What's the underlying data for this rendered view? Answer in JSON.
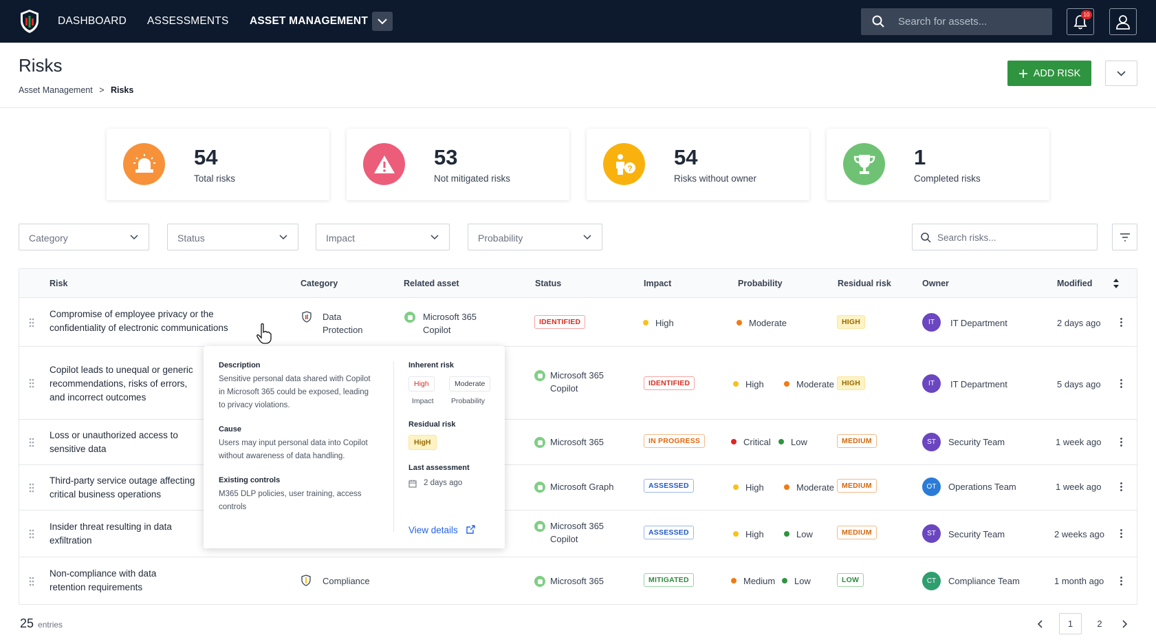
{
  "nav": {
    "items": [
      "DASHBOARD",
      "ASSESSMENTS",
      "ASSET MANAGEMENT"
    ],
    "search_placeholder": "Search for assets...",
    "notifications_count": "10"
  },
  "page": {
    "title": "Risks",
    "breadcrumb_parent": "Asset Management",
    "breadcrumb_sep": ">",
    "breadcrumb_current": "Risks",
    "add_button": "ADD RISK"
  },
  "cards": [
    {
      "number": "54",
      "label": "Total risks",
      "color": "#f7923a",
      "icon": "siren-icon"
    },
    {
      "number": "53",
      "label": "Not mitigated risks",
      "color": "#ec5d7a",
      "icon": "warning-icon"
    },
    {
      "number": "54",
      "label": "Risks without owner",
      "color": "#f9b20d",
      "icon": "person-question-icon"
    },
    {
      "number": "1",
      "label": "Completed risks",
      "color": "#6fc274",
      "icon": "trophy-icon"
    }
  ],
  "filters": {
    "category": "Category",
    "status": "Status",
    "impact": "Impact",
    "probability": "Probability",
    "search_placeholder": "Search risks..."
  },
  "table": {
    "headers": {
      "risk": "Risk",
      "category": "Category",
      "asset": "Related asset",
      "status": "Status",
      "impact": "Impact",
      "probability": "Probability",
      "residual": "Residual risk",
      "owner": "Owner",
      "modified": "Modified"
    },
    "rows": [
      {
        "risk1": "Compromise of employee privacy or the",
        "risk2": "confidentiality of electronic communications",
        "cat1": "Data",
        "cat2": "Protection",
        "asset1": "Microsoft 365",
        "asset2": "Copilot",
        "status": "IDENTIFIED",
        "impact": "High",
        "probability": "Moderate",
        "residual": "HIGH",
        "owner_initials": "IT",
        "owner": "IT Department",
        "modified": "2 days ago"
      },
      {
        "risk1": "Copilot leads to unequal or generic",
        "risk2": "recommendations, risks of errors,",
        "risk3": "and incorrect outcomes",
        "asset1": "Microsoft 365",
        "asset2": "Copilot",
        "status": "IDENTIFIED",
        "impact": "High",
        "probability": "Moderate",
        "residual": "HIGH",
        "owner_initials": "IT",
        "owner": "IT Department",
        "modified": "5 days ago"
      },
      {
        "risk1": "Loss or unauthorized access to",
        "risk2": "sensitive data",
        "asset1": "Microsoft 365",
        "status": "IN PROGRESS",
        "impact": "Critical",
        "probability": "Low",
        "residual": "MEDIUM",
        "owner_initials": "ST",
        "owner": "Security Team",
        "modified": "1 week ago"
      },
      {
        "risk1": "Third-party service outage affecting",
        "risk2": "critical business operations",
        "asset1": "Microsoft Graph",
        "status": "ASSESSED",
        "impact": "High",
        "probability": "Moderate",
        "residual": "MEDIUM",
        "owner_initials": "OT",
        "owner": "Operations Team",
        "modified": "1 week ago"
      },
      {
        "risk1": "Insider threat resulting in data",
        "risk2": "exfiltration",
        "asset1": "Microsoft 365",
        "asset2": "Copilot",
        "status": "ASSESSED",
        "impact": "High",
        "probability": "Low",
        "residual": "MEDIUM",
        "owner_initials": "ST",
        "owner": "Security Team",
        "modified": "2 weeks ago"
      },
      {
        "risk1": "Non-compliance with data",
        "risk2": "retention requirements",
        "cat1": "Compliance",
        "asset1": "Microsoft 365",
        "status": "MITIGATED",
        "impact": "Medium",
        "probability": "Low",
        "residual": "LOW",
        "owner_initials": "CT",
        "owner": "Compliance Team",
        "modified": "1 month ago"
      }
    ]
  },
  "popup": {
    "description_h": "Description",
    "description": [
      "Sensitive personal data shared with Copilot",
      "in Microsoft 365 could be exposed, leading",
      "to privacy violations."
    ],
    "cause_h": "Cause",
    "cause": [
      "Users may input personal data into Copilot",
      "without awareness of data handling."
    ],
    "controls_h": "Existing controls",
    "controls": [
      "M365 DLP policies, user training, access",
      "controls"
    ],
    "inherent_h": "Inherent risk",
    "inherent_impact": "High",
    "inherent_probability": "Moderate",
    "impact_label": "Impact",
    "probability_label": "Probability",
    "residual_h": "Residual risk",
    "residual": "HigH",
    "last_h": "Last assessment",
    "last": "2 days ago",
    "view": "View details"
  },
  "pagination": {
    "entries_count": "25",
    "entries_label": "entries",
    "pages": [
      "1",
      "2"
    ]
  }
}
